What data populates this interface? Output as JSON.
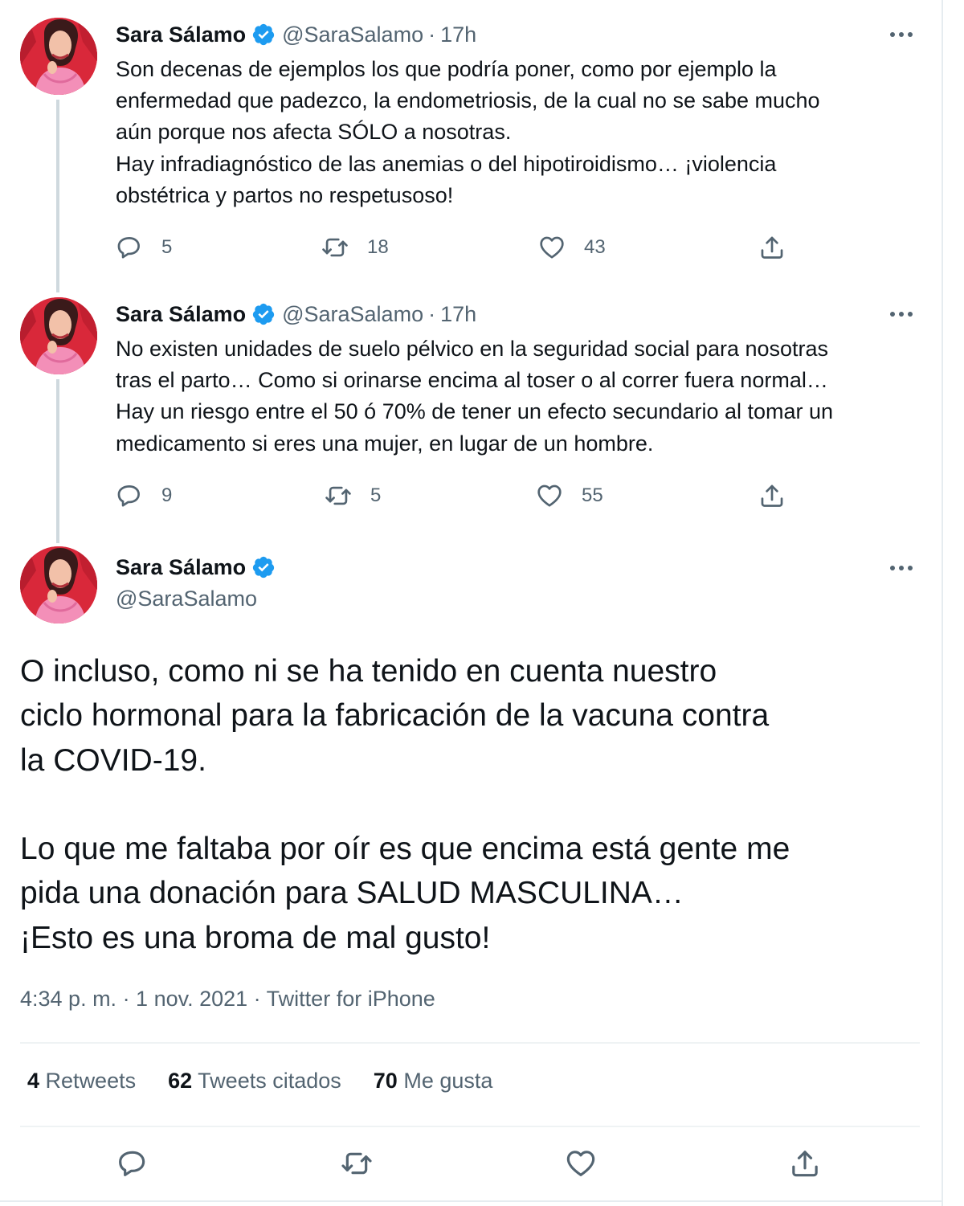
{
  "author": {
    "name": "Sara Sálamo",
    "handle": "@SaraSalamo"
  },
  "tweets": [
    {
      "time": "17h",
      "text": "Son decenas de ejemplos los que podría poner, como por ejemplo la\nenfermedad que padezco, la endometriosis, de la cual no se sabe mucho\naún porque nos afecta SÓLO a nosotras.\nHay infradiagnóstico de las anemias o del hipotiroidismo… ¡violencia\nobstétrica y partos no respetusoso!",
      "replies": "5",
      "retweets": "18",
      "likes": "43"
    },
    {
      "time": "17h",
      "text": "No existen unidades de suelo pélvico en la seguridad social para nosotras\ntras el parto… Como si orinarse encima al toser o al correr fuera normal…\nHay un riesgo entre el 50 ó 70% de tener un efecto secundario al tomar un\nmedicamento si eres una mujer, en lugar de un hombre.",
      "replies": "9",
      "retweets": "5",
      "likes": "55"
    }
  ],
  "main_tweet": {
    "text": "O incluso, como ni se ha tenido en cuenta nuestro\nciclo hormonal para la fabricación de la vacuna contra\nla COVID-19.\n\nLo que me faltaba por oír es que encima está gente me\npida una donación para SALUD MASCULINA…\n¡Esto es una broma de mal gusto!",
    "timestamp": "4:34 p. m. · 1 nov. 2021 · Twitter for iPhone",
    "stats": {
      "retweets_count": "4",
      "retweets_label": "Retweets",
      "quotes_count": "62",
      "quotes_label": "Tweets citados",
      "likes_count": "70",
      "likes_label": "Me gusta"
    }
  },
  "separator": "·",
  "icons": {
    "verified": "verified-badge-icon",
    "reply": "reply-icon",
    "retweet": "retweet-icon",
    "like": "heart-icon",
    "share": "share-icon",
    "more": "more-icon"
  },
  "colors": {
    "verified_blue": "#1d9bf0",
    "text_primary": "#0f1419",
    "text_secondary": "#536471",
    "thread_line": "#cfd9de",
    "divider": "#eff3f4"
  }
}
